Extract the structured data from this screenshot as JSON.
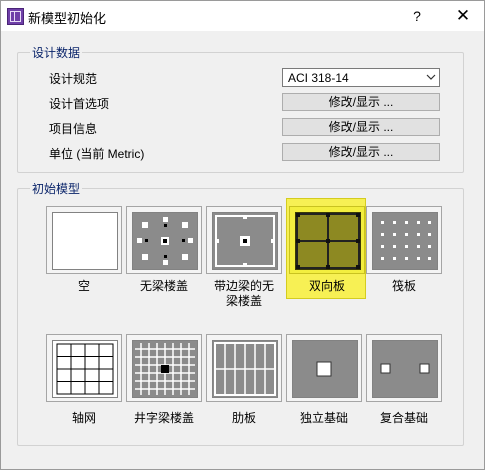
{
  "window": {
    "title": "新模型初始化",
    "help": "?",
    "close": "✕"
  },
  "design_data": {
    "label": "设计数据",
    "code_label": "设计规范",
    "code_value": "ACI 318-14",
    "preferences_label": "设计首选项",
    "project_info_label": "项目信息",
    "units_label": "单位 (当前 Metric)",
    "modify_button": "修改/显示 ..."
  },
  "initial_model": {
    "label": "初始模型",
    "items": [
      {
        "name": "空"
      },
      {
        "name": "无梁楼盖"
      },
      {
        "name_line1": "带边梁的无",
        "name_line2": "梁楼盖"
      },
      {
        "name": "双向板",
        "selected": true
      },
      {
        "name": "筏板"
      },
      {
        "name": "轴网"
      },
      {
        "name": "井字梁楼盖"
      },
      {
        "name": "肋板"
      },
      {
        "name": "独立基础"
      },
      {
        "name": "复合基础"
      }
    ]
  }
}
